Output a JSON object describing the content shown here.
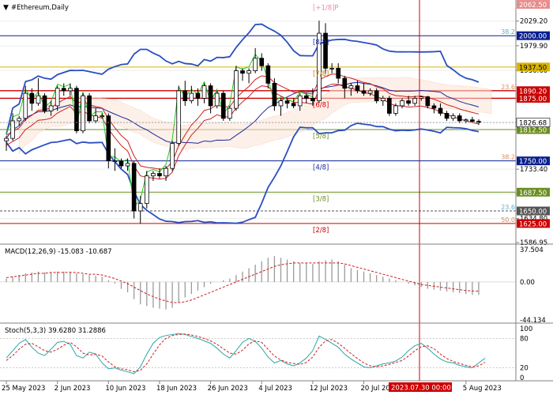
{
  "window": {
    "title": "#Ethereum,Daily",
    "color_theme": {
      "background": "#ffffff",
      "grid": "#d0d0d0",
      "separator": "#808080"
    }
  },
  "chart_data": [
    {
      "type": "candlestick",
      "symbol": "#Ethereum",
      "timeframe": "Daily",
      "x_tick_labels": [
        "25 May 2023",
        "2 Jun 2023",
        "10 Jun 2023",
        "18 Jun 2023",
        "26 Jun 2023",
        "4 Jul 2023",
        "12 Jul 2023",
        "20 Jul 2023",
        "5 Aug 2023"
      ],
      "crosshair_time_label": "2023.07.30 00:00",
      "y_tick_labels": [
        "2029.20",
        "1979.90",
        "1930.60",
        "1875.00",
        "1826.68",
        "1812.50",
        "1733.40",
        "1684.10",
        "1634.80",
        "1586.95"
      ],
      "ylim": [
        1586.95,
        2065
      ],
      "ohlc": [
        {
          "date": "2023-05-25",
          "open": 1790,
          "high": 1800,
          "low": 1770,
          "close": 1795
        },
        {
          "date": "2023-05-26",
          "open": 1795,
          "high": 1845,
          "low": 1790,
          "close": 1830
        },
        {
          "date": "2023-05-27",
          "open": 1830,
          "high": 1840,
          "low": 1820,
          "close": 1835
        },
        {
          "date": "2023-05-28",
          "open": 1835,
          "high": 1900,
          "low": 1830,
          "close": 1885
        },
        {
          "date": "2023-05-29",
          "open": 1885,
          "high": 1895,
          "low": 1850,
          "close": 1865
        },
        {
          "date": "2023-05-30",
          "open": 1865,
          "high": 1915,
          "low": 1860,
          "close": 1880
        },
        {
          "date": "2023-05-31",
          "open": 1880,
          "high": 1885,
          "low": 1845,
          "close": 1850
        },
        {
          "date": "2023-06-01",
          "open": 1850,
          "high": 1870,
          "low": 1840,
          "close": 1860
        },
        {
          "date": "2023-06-02",
          "open": 1860,
          "high": 1900,
          "low": 1850,
          "close": 1895
        },
        {
          "date": "2023-06-03",
          "open": 1895,
          "high": 1905,
          "low": 1880,
          "close": 1890
        },
        {
          "date": "2023-06-04",
          "open": 1890,
          "high": 1905,
          "low": 1880,
          "close": 1895
        },
        {
          "date": "2023-06-05",
          "open": 1895,
          "high": 1900,
          "low": 1805,
          "close": 1810
        },
        {
          "date": "2023-06-06",
          "open": 1810,
          "high": 1885,
          "low": 1805,
          "close": 1880
        },
        {
          "date": "2023-06-07",
          "open": 1880,
          "high": 1885,
          "low": 1825,
          "close": 1830
        },
        {
          "date": "2023-06-08",
          "open": 1830,
          "high": 1855,
          "low": 1825,
          "close": 1840
        },
        {
          "date": "2023-06-09",
          "open": 1840,
          "high": 1845,
          "low": 1835,
          "close": 1840
        },
        {
          "date": "2023-06-10",
          "open": 1840,
          "high": 1845,
          "low": 1735,
          "close": 1750
        },
        {
          "date": "2023-06-11",
          "open": 1750,
          "high": 1775,
          "low": 1730,
          "close": 1750
        },
        {
          "date": "2023-06-12",
          "open": 1750,
          "high": 1755,
          "low": 1735,
          "close": 1740
        },
        {
          "date": "2023-06-13",
          "open": 1740,
          "high": 1755,
          "low": 1730,
          "close": 1745
        },
        {
          "date": "2023-06-14",
          "open": 1745,
          "high": 1750,
          "low": 1635,
          "close": 1650
        },
        {
          "date": "2023-06-15",
          "open": 1650,
          "high": 1680,
          "low": 1625,
          "close": 1665
        },
        {
          "date": "2023-06-16",
          "open": 1665,
          "high": 1730,
          "low": 1655,
          "close": 1720
        },
        {
          "date": "2023-06-17",
          "open": 1720,
          "high": 1730,
          "low": 1710,
          "close": 1725
        },
        {
          "date": "2023-06-18",
          "open": 1725,
          "high": 1735,
          "low": 1715,
          "close": 1720
        },
        {
          "date": "2023-06-19",
          "open": 1720,
          "high": 1740,
          "low": 1710,
          "close": 1735
        },
        {
          "date": "2023-06-20",
          "open": 1735,
          "high": 1790,
          "low": 1730,
          "close": 1785
        },
        {
          "date": "2023-06-21",
          "open": 1785,
          "high": 1900,
          "low": 1780,
          "close": 1890
        },
        {
          "date": "2023-06-22",
          "open": 1890,
          "high": 1910,
          "low": 1860,
          "close": 1870
        },
        {
          "date": "2023-06-23",
          "open": 1870,
          "high": 1900,
          "low": 1865,
          "close": 1885
        },
        {
          "date": "2023-06-24",
          "open": 1885,
          "high": 1895,
          "low": 1860,
          "close": 1875
        },
        {
          "date": "2023-06-25",
          "open": 1875,
          "high": 1905,
          "low": 1865,
          "close": 1900
        },
        {
          "date": "2023-06-26",
          "open": 1900,
          "high": 1905,
          "low": 1845,
          "close": 1860
        },
        {
          "date": "2023-06-27",
          "open": 1860,
          "high": 1890,
          "low": 1855,
          "close": 1885
        },
        {
          "date": "2023-06-28",
          "open": 1885,
          "high": 1890,
          "low": 1830,
          "close": 1835
        },
        {
          "date": "2023-06-29",
          "open": 1835,
          "high": 1860,
          "low": 1830,
          "close": 1855
        },
        {
          "date": "2023-06-30",
          "open": 1855,
          "high": 1940,
          "low": 1850,
          "close": 1930
        },
        {
          "date": "2023-07-01",
          "open": 1930,
          "high": 1935,
          "low": 1910,
          "close": 1925
        },
        {
          "date": "2023-07-02",
          "open": 1925,
          "high": 1935,
          "low": 1905,
          "close": 1930
        },
        {
          "date": "2023-07-03",
          "open": 1930,
          "high": 1975,
          "low": 1925,
          "close": 1955
        },
        {
          "date": "2023-07-04",
          "open": 1955,
          "high": 1965,
          "low": 1930,
          "close": 1940
        },
        {
          "date": "2023-07-05",
          "open": 1940,
          "high": 1945,
          "low": 1895,
          "close": 1905
        },
        {
          "date": "2023-07-06",
          "open": 1905,
          "high": 1915,
          "low": 1850,
          "close": 1860
        },
        {
          "date": "2023-07-07",
          "open": 1860,
          "high": 1875,
          "low": 1840,
          "close": 1870
        },
        {
          "date": "2023-07-08",
          "open": 1870,
          "high": 1875,
          "low": 1855,
          "close": 1865
        },
        {
          "date": "2023-07-09",
          "open": 1865,
          "high": 1875,
          "low": 1855,
          "close": 1860
        },
        {
          "date": "2023-07-10",
          "open": 1860,
          "high": 1885,
          "low": 1850,
          "close": 1880
        },
        {
          "date": "2023-07-11",
          "open": 1880,
          "high": 1885,
          "low": 1865,
          "close": 1875
        },
        {
          "date": "2023-07-12",
          "open": 1875,
          "high": 1895,
          "low": 1860,
          "close": 1870
        },
        {
          "date": "2023-07-13",
          "open": 1870,
          "high": 2030,
          "low": 1865,
          "close": 2005
        },
        {
          "date": "2023-07-14",
          "open": 2005,
          "high": 2025,
          "low": 1925,
          "close": 1935
        },
        {
          "date": "2023-07-15",
          "open": 1935,
          "high": 1945,
          "low": 1925,
          "close": 1935
        },
        {
          "date": "2023-07-16",
          "open": 1935,
          "high": 1945,
          "low": 1905,
          "close": 1915
        },
        {
          "date": "2023-07-17",
          "open": 1915,
          "high": 1920,
          "low": 1875,
          "close": 1895
        },
        {
          "date": "2023-07-18",
          "open": 1895,
          "high": 1905,
          "low": 1880,
          "close": 1900
        },
        {
          "date": "2023-07-19",
          "open": 1900,
          "high": 1910,
          "low": 1885,
          "close": 1890
        },
        {
          "date": "2023-07-20",
          "open": 1890,
          "high": 1905,
          "low": 1880,
          "close": 1885
        },
        {
          "date": "2023-07-21",
          "open": 1885,
          "high": 1895,
          "low": 1880,
          "close": 1890
        },
        {
          "date": "2023-07-22",
          "open": 1890,
          "high": 1895,
          "low": 1865,
          "close": 1870
        },
        {
          "date": "2023-07-23",
          "open": 1870,
          "high": 1880,
          "low": 1860,
          "close": 1875
        },
        {
          "date": "2023-07-24",
          "open": 1875,
          "high": 1880,
          "low": 1840,
          "close": 1845
        },
        {
          "date": "2023-07-25",
          "open": 1845,
          "high": 1865,
          "low": 1840,
          "close": 1860
        },
        {
          "date": "2023-07-26",
          "open": 1860,
          "high": 1875,
          "low": 1855,
          "close": 1870
        },
        {
          "date": "2023-07-27",
          "open": 1870,
          "high": 1880,
          "low": 1860,
          "close": 1865
        },
        {
          "date": "2023-07-28",
          "open": 1865,
          "high": 1880,
          "low": 1860,
          "close": 1875
        },
        {
          "date": "2023-07-29",
          "open": 1875,
          "high": 1880,
          "low": 1870,
          "close": 1878
        },
        {
          "date": "2023-07-30",
          "open": 1878,
          "high": 1880,
          "low": 1855,
          "close": 1860
        },
        {
          "date": "2023-07-31",
          "open": 1860,
          "high": 1865,
          "low": 1845,
          "close": 1855
        },
        {
          "date": "2023-08-01",
          "open": 1855,
          "high": 1865,
          "low": 1840,
          "close": 1845
        },
        {
          "date": "2023-08-02",
          "open": 1845,
          "high": 1850,
          "low": 1830,
          "close": 1835
        },
        {
          "date": "2023-08-03",
          "open": 1835,
          "high": 1845,
          "low": 1830,
          "close": 1840
        },
        {
          "date": "2023-08-04",
          "open": 1840,
          "high": 1845,
          "low": 1825,
          "close": 1830
        },
        {
          "date": "2023-08-05",
          "open": 1830,
          "high": 1835,
          "low": 1825,
          "close": 1832
        },
        {
          "date": "2023-08-06",
          "open": 1832,
          "high": 1838,
          "low": 1826,
          "close": 1829
        },
        {
          "date": "2023-08-07",
          "open": 1829,
          "high": 1833,
          "low": 1822,
          "close": 1826.68
        }
      ],
      "price_levels": [
        {
          "label": "2000.00",
          "value": 2000,
          "color": "#0a1f8f",
          "style": "solid",
          "name": ""
        },
        {
          "label": "1937.50",
          "value": 1937.5,
          "color": "#d8b400",
          "style": "solid",
          "name": ""
        },
        {
          "label": "1890.20",
          "value": 1890.2,
          "color": "#cc0000",
          "style": "solid",
          "name": ""
        },
        {
          "label": "1875.00",
          "value": 1875,
          "color": "#cc0000",
          "style": "solid",
          "name": ""
        },
        {
          "label": "1812.50",
          "value": 1812.5,
          "color": "#6b8e23",
          "style": "solid",
          "name": ""
        },
        {
          "label": "1750.00",
          "value": 1750,
          "color": "#0a1f8f",
          "style": "solid",
          "name": ""
        },
        {
          "label": "1687.50",
          "value": 1687.5,
          "color": "#6b8e23",
          "style": "solid",
          "name": ""
        },
        {
          "label": "1650.00",
          "value": 1650,
          "color": "#555555",
          "style": "dash",
          "name": ""
        },
        {
          "label": "1625.00",
          "value": 1625,
          "color": "#cc0000",
          "style": "solid",
          "name": ""
        },
        {
          "label": "2062.50",
          "value": 2062.5,
          "color": "#e88a8a",
          "style": "none",
          "name": ""
        }
      ],
      "murrey_labels": [
        {
          "text": "[+1/8]P",
          "value": 2062.5,
          "color": "#e58ab0"
        },
        {
          "text": "[8/8]",
          "value": 2000,
          "color": "#1a2a9f"
        },
        {
          "text": "[7/8]",
          "value": 1937.5,
          "color": "#c08000"
        },
        {
          "text": "[6/8]",
          "value": 1875,
          "color": "#cc0000"
        },
        {
          "text": "[5/8]",
          "value": 1812.5,
          "color": "#6b8e23"
        },
        {
          "text": "[4/8]",
          "value": 1750,
          "color": "#1a2a9f"
        },
        {
          "text": "[3/8]",
          "value": 1687.5,
          "color": "#6b8e23"
        },
        {
          "text": "[2/8]",
          "value": 1625,
          "color": "#cc0000"
        }
      ],
      "fib_labels": [
        {
          "text": "38.2",
          "value": 2000,
          "color": "#5fb0c8"
        },
        {
          "text": "23.6",
          "value": 1890.2,
          "color": "#e08a50"
        },
        {
          "text": "38.2",
          "value": 1750,
          "color": "#e08a50"
        },
        {
          "text": "23.6",
          "value": 1650,
          "color": "#5fb0c8"
        },
        {
          "text": "50.0",
          "value": 1625,
          "color": "#e08a50"
        }
      ],
      "current_price": 1826.68
    },
    {
      "type": "macd",
      "label": "MACD(12,26,9) -15.083 -10.687",
      "y_tick_labels": [
        "37.504",
        "0.00",
        "-44.134"
      ],
      "ylim": [
        -44.134,
        37.504
      ],
      "histogram": [
        4,
        6,
        8,
        10,
        11,
        12,
        11,
        11,
        12,
        12,
        12,
        10,
        9,
        8,
        7,
        6,
        2,
        -2,
        -8,
        -12,
        -20,
        -26,
        -28,
        -30,
        -31,
        -32,
        -30,
        -24,
        -18,
        -14,
        -10,
        -6,
        -2,
        0,
        2,
        4,
        8,
        12,
        16,
        20,
        24,
        28,
        30,
        28,
        26,
        24,
        22,
        22,
        21,
        24,
        25,
        26,
        24,
        20,
        16,
        14,
        12,
        10,
        8,
        6,
        4,
        2,
        0,
        -2,
        -4,
        -6,
        -8,
        -9,
        -10,
        -11,
        -12,
        -13,
        -14,
        -15,
        -15.083
      ],
      "signal": [
        5,
        6,
        7,
        8,
        9,
        10,
        10,
        11,
        11,
        11,
        11,
        11,
        10,
        9,
        9,
        8,
        6,
        4,
        1,
        -2,
        -6,
        -10,
        -14,
        -17,
        -20,
        -22,
        -24,
        -24,
        -23,
        -21,
        -18,
        -15,
        -12,
        -9,
        -6,
        -3,
        0,
        3,
        6,
        9,
        12,
        15,
        18,
        20,
        21,
        22,
        22,
        22,
        22,
        22,
        22,
        22,
        22,
        21,
        19,
        17,
        15,
        13,
        11,
        9,
        7,
        5,
        3,
        1,
        -1,
        -3,
        -4,
        -5,
        -6,
        -7,
        -8,
        -9,
        -10,
        -10.5,
        -10.687
      ]
    },
    {
      "type": "stochastic",
      "label": "Stoch(5,3,3) 39.6280 31.2886",
      "y_tick_labels": [
        "100",
        "80",
        "20",
        "0"
      ],
      "ylim": [
        0,
        100
      ],
      "k": [
        40,
        55,
        70,
        78,
        62,
        50,
        45,
        58,
        72,
        74,
        68,
        45,
        40,
        52,
        48,
        30,
        18,
        20,
        15,
        12,
        8,
        22,
        48,
        70,
        82,
        86,
        88,
        90,
        88,
        84,
        80,
        75,
        70,
        60,
        48,
        40,
        55,
        72,
        80,
        74,
        60,
        42,
        30,
        35,
        28,
        24,
        30,
        40,
        55,
        85,
        78,
        70,
        62,
        48,
        38,
        30,
        22,
        20,
        24,
        28,
        30,
        34,
        42,
        55,
        65,
        70,
        60,
        48,
        38,
        32,
        30,
        25,
        22,
        20,
        30,
        39.628
      ],
      "d": [
        35,
        45,
        58,
        68,
        70,
        63,
        55,
        52,
        58,
        66,
        72,
        63,
        50,
        46,
        48,
        44,
        32,
        22,
        18,
        16,
        12,
        15,
        28,
        48,
        67,
        80,
        86,
        88,
        89,
        87,
        84,
        80,
        75,
        68,
        59,
        50,
        48,
        56,
        69,
        75,
        72,
        58,
        44,
        36,
        31,
        29,
        27,
        31,
        42,
        62,
        75,
        78,
        70,
        60,
        49,
        39,
        30,
        24,
        22,
        24,
        27,
        31,
        35,
        44,
        55,
        63,
        65,
        59,
        48,
        39,
        33,
        29,
        25,
        22,
        24,
        31.2886
      ]
    }
  ]
}
